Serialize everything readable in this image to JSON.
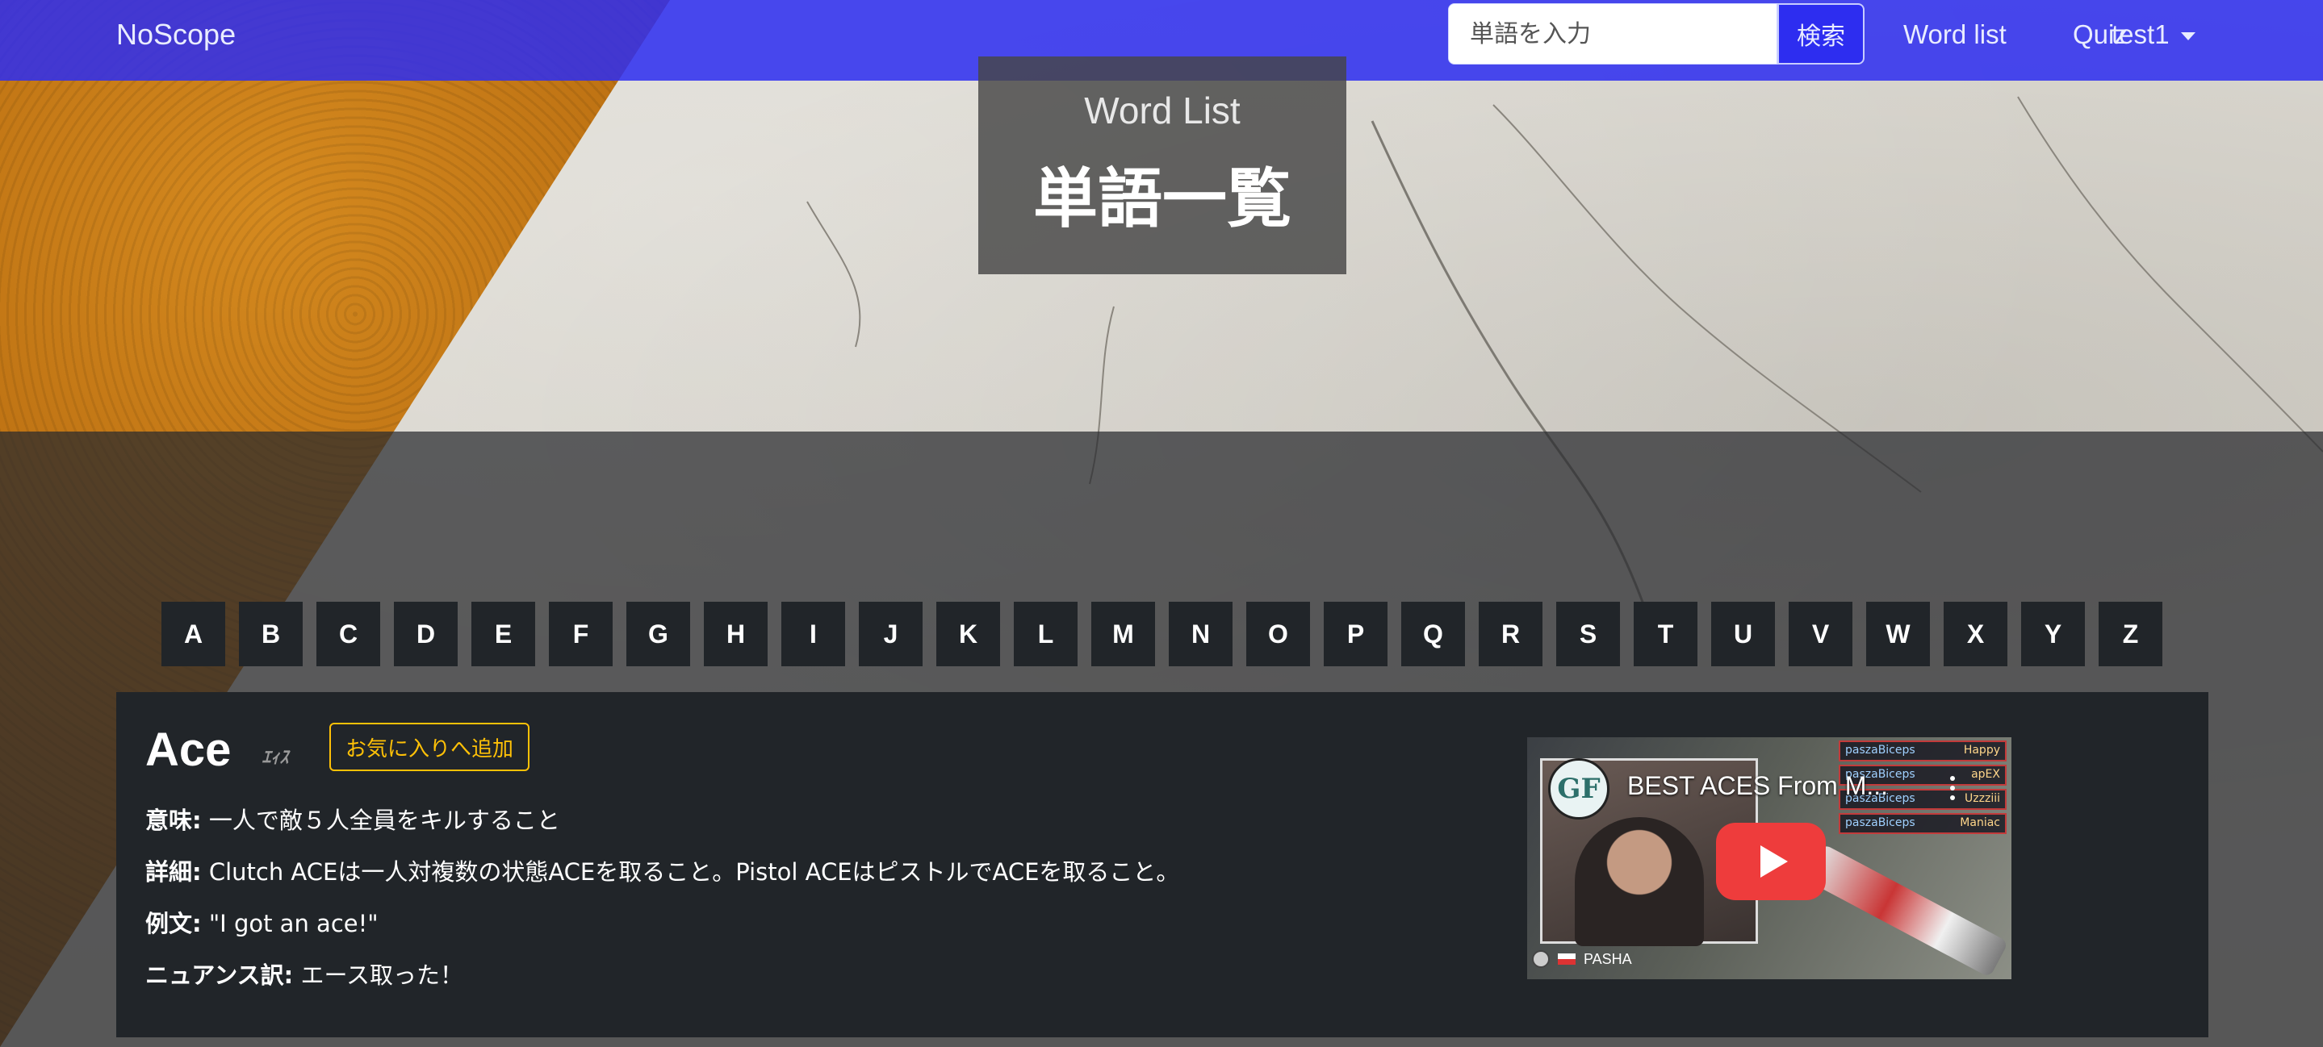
{
  "navbar": {
    "brand": "NoScope",
    "search_placeholder": "単語を入力",
    "search_button": "検索",
    "links": {
      "word_list": "Word list",
      "quiz": "Quiz"
    },
    "user": "test1",
    "color": "#2d2df0"
  },
  "hero": {
    "title_en": "Word List",
    "title_ja": "単語一覧"
  },
  "alphabet": [
    "A",
    "B",
    "C",
    "D",
    "E",
    "F",
    "G",
    "H",
    "I",
    "J",
    "K",
    "L",
    "M",
    "N",
    "O",
    "P",
    "Q",
    "R",
    "S",
    "T",
    "U",
    "V",
    "W",
    "X",
    "Y",
    "Z"
  ],
  "word": {
    "term": "Ace",
    "reading": "ｴｨｽ",
    "favorite_button": "お気に入りへ追加",
    "meaning_label": "意味:",
    "meaning": "一人で敵５人全員をキルすること",
    "detail_label": "詳細:",
    "detail": "Clutch ACEは一人対複数の状態ACEを取ること。Pistol ACEはピストルでACEを取ること。",
    "example_label": "例文:",
    "example": "\"I got an ace!\"",
    "nuance_label": "ニュアンス訳:",
    "nuance": "エース取った！",
    "accent_color": "#ffc107"
  },
  "video": {
    "channel_logo": "GF",
    "title": "BEST ACES From M...",
    "killfeed": [
      {
        "player": "paszaBiceps",
        "victim": "Happy"
      },
      {
        "player": "paszaBiceps",
        "victim": "apEX"
      },
      {
        "player": "paszaBiceps",
        "victim": "Uzzziii"
      },
      {
        "player": "paszaBiceps",
        "victim": "Maniac"
      }
    ],
    "footer_name": "PASHA",
    "play_icon": "play-icon"
  }
}
